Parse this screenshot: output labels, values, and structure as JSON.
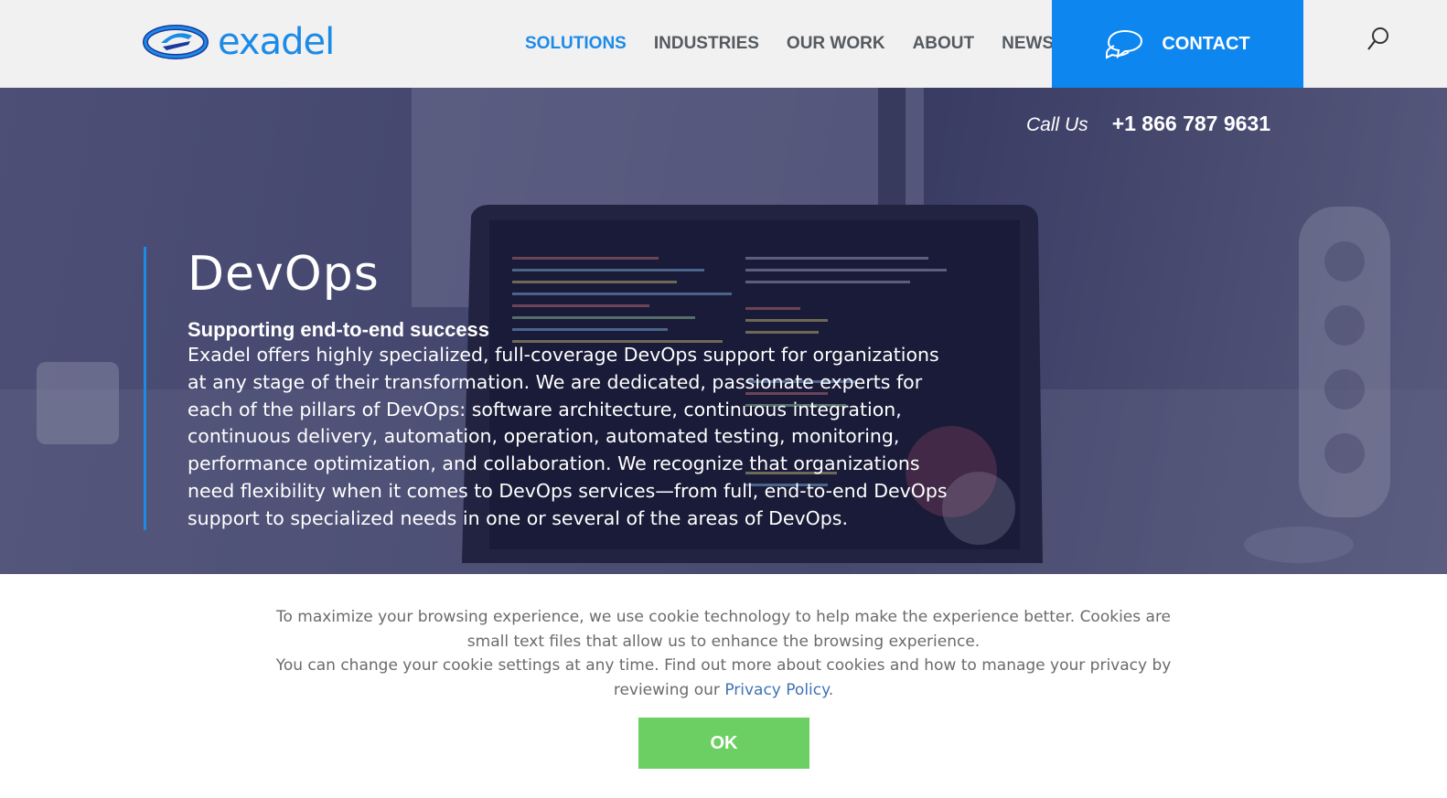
{
  "brand": {
    "name": "exadel",
    "accent_color": "#1c8be6",
    "contact_color": "#0d86ef",
    "ok_color": "#6ccf63"
  },
  "nav": {
    "items": [
      {
        "label": "SOLUTIONS",
        "active": true
      },
      {
        "label": "INDUSTRIES",
        "active": false
      },
      {
        "label": "OUR WORK",
        "active": false
      },
      {
        "label": "ABOUT",
        "active": false
      },
      {
        "label": "NEWS",
        "active": false
      }
    ],
    "contact_label": "CONTACT",
    "contact_icon": "chat-bubbles-icon",
    "search_icon": "search-icon"
  },
  "hero": {
    "callus_label": "Call Us",
    "phone": "+1 866 787 9631",
    "title": "DevOps",
    "subtitle": "Supporting end-to-end success",
    "body": "Exadel offers highly specialized, full-coverage DevOps support for organizations at any stage of their transformation. We are dedicated, passionate experts for each of the pillars of DevOps: software architecture, continuous integration, continuous delivery, automation, operation, automated testing, monitoring, performance optimization, and collaboration. We recognize that organizations need flexibility when it comes to DevOps services—from full, end-to-end DevOps support to specialized needs in one or several of the areas of DevOps."
  },
  "cookie": {
    "line1": "To maximize your browsing experience, we use cookie technology to help make the experience better. Cookies are small text files that allow us to enhance the browsing experience.",
    "line2": "You can change your cookie settings at any time. Find out more about cookies and how to manage your privacy by reviewing our",
    "link_label": "Privacy Policy",
    "line2_end": ".",
    "ok_label": "OK"
  }
}
